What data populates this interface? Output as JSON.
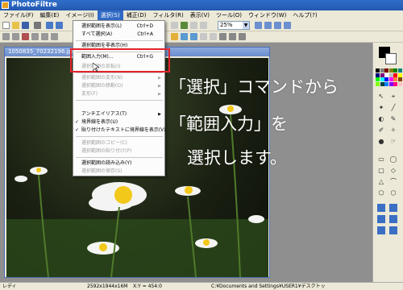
{
  "app": {
    "title": "PhotoFiltre"
  },
  "menubar": [
    {
      "label": "ファイル(F)"
    },
    {
      "label": "編集(E)"
    },
    {
      "label": "イメージ(I)"
    },
    {
      "label": "選択(S)",
      "active": true
    },
    {
      "label": "補正(D)"
    },
    {
      "label": "フィルタ(R)"
    },
    {
      "label": "表示(V)"
    },
    {
      "label": "ツール(O)"
    },
    {
      "label": "ウィンドウ(W)"
    },
    {
      "label": "ヘルプ(?)"
    }
  ],
  "toolbar": {
    "zoom": "25%"
  },
  "document": {
    "title": "1050835_70232196.jpg"
  },
  "menu": {
    "items": [
      {
        "label": "選択範囲を表示(L)",
        "shortcut": "Ctrl+D"
      },
      {
        "label": "すべて選択(A)",
        "shortcut": "Ctrl+A"
      },
      {
        "label": "選択範囲を非表示(H)",
        "shortcut": ""
      },
      {
        "label": "範囲入力(M)...",
        "shortcut": "Ctrl+G"
      },
      {
        "label": "選択範囲の反転(I)",
        "shortcut": ""
      },
      {
        "label": "選択範囲の変形(N)",
        "shortcut": ""
      },
      {
        "label": "選択範囲の移動(O)",
        "shortcut": ""
      },
      {
        "label": "変形(F)",
        "shortcut": ""
      },
      {
        "label": "アンチエイリアス(T)",
        "shortcut": ""
      },
      {
        "label": "境界線を表示(U)",
        "shortcut": ""
      },
      {
        "label": "貼り付けたテキストに境界線を表示(V)",
        "shortcut": ""
      },
      {
        "label": "選択範囲のコピー(C)",
        "shortcut": ""
      },
      {
        "label": "選択範囲の貼り付け(P)",
        "shortcut": ""
      },
      {
        "label": "選択範囲の読み込み(Y)",
        "shortcut": ""
      },
      {
        "label": "選択範囲の保存(S)",
        "shortcut": ""
      }
    ]
  },
  "overlay": {
    "line1": "「選択」コマンドから",
    "line2": "「範囲入力」を",
    "line3": "選択します。"
  },
  "status": {
    "ready": "レディ",
    "dims": "2592x1944x16M",
    "coords": "X:Y = 454:0",
    "path": "C:¥Documents and Settings¥USER1¥デスクトッ"
  },
  "colors": {
    "accent": "#316ac5",
    "highlight": "#e3242b",
    "overlay_text": "#ffffff"
  }
}
